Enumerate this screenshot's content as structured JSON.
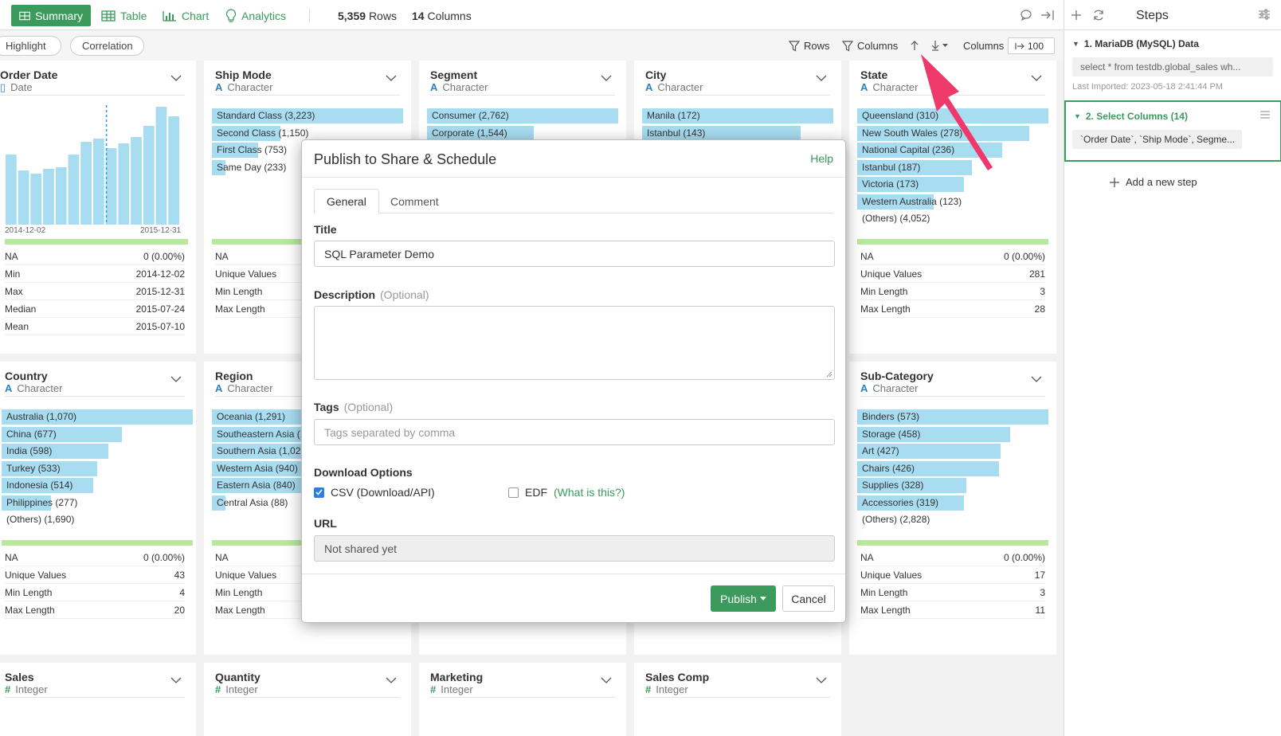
{
  "toolbar": {
    "summary": "Summary",
    "table": "Table",
    "chart": "Chart",
    "analytics": "Analytics",
    "rows_count": "5,359",
    "rows_label": "Rows",
    "cols_count": "14",
    "cols_label": "Columns"
  },
  "subbar": {
    "highlight": "Highlight",
    "correlation": "Correlation",
    "rows": "Rows",
    "columns": "Columns",
    "columns_label": "Columns",
    "columns_value": "100"
  },
  "cards": {
    "order_date": {
      "name": "Order Date",
      "type": "Date",
      "hist_start": "2014-12-02",
      "hist_end": "2015-12-31",
      "hist_values": [
        88,
        68,
        64,
        70,
        72,
        88,
        104,
        108,
        96,
        102,
        110,
        124,
        148,
        136
      ],
      "stats": [
        [
          "NA",
          "0 (0.00%)"
        ],
        [
          "Min",
          "2014-12-02"
        ],
        [
          "Max",
          "2015-12-31"
        ],
        [
          "Median",
          "2015-07-24"
        ],
        [
          "Mean",
          "2015-07-10"
        ]
      ]
    },
    "ship_mode": {
      "name": "Ship Mode",
      "type": "Character",
      "bars": [
        [
          "Standard Class (3,223)",
          1.0
        ],
        [
          "Second Class (1,150)",
          0.36
        ],
        [
          "First Class (753)",
          0.24
        ],
        [
          "Same Day (233)",
          0.07
        ]
      ],
      "stats": [
        [
          "NA",
          ""
        ],
        [
          "Unique Values",
          ""
        ],
        [
          "Min Length",
          ""
        ],
        [
          "Max Length",
          ""
        ]
      ]
    },
    "segment": {
      "name": "Segment",
      "type": "Character",
      "bars": [
        [
          "Consumer (2,762)",
          1.0
        ],
        [
          "Corporate (1,544)",
          0.56
        ]
      ]
    },
    "city": {
      "name": "City",
      "type": "Character",
      "bars": [
        [
          "Manila (172)",
          1.0
        ],
        [
          "Istanbul (143)",
          0.83
        ]
      ]
    },
    "state": {
      "name": "State",
      "type": "Character",
      "bars": [
        [
          "Queensland (310)",
          1.0
        ],
        [
          "New South Wales (278)",
          0.9
        ],
        [
          "National Capital (236)",
          0.76
        ],
        [
          "Istanbul (187)",
          0.6
        ],
        [
          "Victoria (173)",
          0.56
        ],
        [
          "Western Australia (123)",
          0.4
        ],
        [
          "(Others) (4,052)",
          0
        ]
      ],
      "stats": [
        [
          "NA",
          "0 (0.00%)"
        ],
        [
          "Unique Values",
          "281"
        ],
        [
          "Min Length",
          "3"
        ],
        [
          "Max Length",
          "28"
        ]
      ]
    },
    "country": {
      "name": "Country",
      "type": "Character",
      "bars": [
        [
          "Australia (1,070)",
          1.0
        ],
        [
          "China (677)",
          0.63
        ],
        [
          "India (598)",
          0.56
        ],
        [
          "Turkey (533)",
          0.5
        ],
        [
          "Indonesia (514)",
          0.48
        ],
        [
          "Philippines (277)",
          0.26
        ],
        [
          "(Others) (1,690)",
          0
        ]
      ],
      "stats": [
        [
          "NA",
          "0 (0.00%)"
        ],
        [
          "Unique Values",
          "43"
        ],
        [
          "Min Length",
          "4"
        ],
        [
          "Max Length",
          "20"
        ]
      ]
    },
    "region": {
      "name": "Region",
      "type": "Character",
      "bars": [
        [
          "Oceania (1,291)",
          1.0
        ],
        [
          "Southeastern Asia (1",
          0.95
        ],
        [
          "Southern Asia (1,020",
          0.9
        ],
        [
          "Western Asia (940)",
          0.73
        ],
        [
          "Eastern Asia (840)",
          0.65
        ],
        [
          "Central Asia (88)",
          0.07
        ]
      ],
      "stats": [
        [
          "NA",
          ""
        ],
        [
          "Unique Values",
          ""
        ],
        [
          "Min Length",
          ""
        ],
        [
          "Max Length",
          ""
        ]
      ]
    },
    "sub_category": {
      "name": "Sub-Category",
      "type": "Character",
      "bars": [
        [
          "Binders (573)",
          1.0
        ],
        [
          "Storage (458)",
          0.8
        ],
        [
          "Art (427)",
          0.75
        ],
        [
          "Chairs (426)",
          0.74
        ],
        [
          "Supplies (328)",
          0.57
        ],
        [
          "Accessories (319)",
          0.56
        ],
        [
          "(Others) (2,828)",
          0
        ]
      ],
      "stats": [
        [
          "NA",
          "0 (0.00%)"
        ],
        [
          "Unique Values",
          "17"
        ],
        [
          "Min Length",
          "3"
        ],
        [
          "Max Length",
          "11"
        ]
      ]
    },
    "sales": {
      "name": "Sales",
      "type": "Integer"
    },
    "quantity": {
      "name": "Quantity",
      "type": "Integer"
    },
    "marketing": {
      "name": "Marketing",
      "type": "Integer"
    },
    "sales_comp": {
      "name": "Sales Comp",
      "type": "Integer"
    }
  },
  "modal": {
    "title": "Publish to Share & Schedule",
    "help": "Help",
    "tab_general": "General",
    "tab_comment": "Comment",
    "title_label": "Title",
    "title_value": "SQL Parameter Demo",
    "desc_label": "Description",
    "desc_optional": "(Optional)",
    "tags_label": "Tags",
    "tags_optional": "(Optional)",
    "tags_placeholder": "Tags separated by comma",
    "download_label": "Download Options",
    "csv_label": "CSV (Download/API)",
    "edf_label": "EDF",
    "edf_link": "(What is this?)",
    "url_label": "URL",
    "url_value": "Not shared yet",
    "publish": "Publish",
    "cancel": "Cancel"
  },
  "steps": {
    "header": "Steps",
    "step1_title": "1. MariaDB (MySQL) Data",
    "step1_code": "select * from testdb.global_sales wh...",
    "step1_meta": "Last Imported: 2023-05-18 2:41:44 PM",
    "step2_title": "2. Select Columns (14)",
    "step2_code": "`Order Date`, `Ship Mode`, Segme...",
    "add_step": "Add a new step"
  },
  "colors": {
    "accent": "#3c9b5c",
    "bar": "#a8dcf0",
    "na_bar": "#b9e79e",
    "arrow": "#ee3a6a"
  }
}
